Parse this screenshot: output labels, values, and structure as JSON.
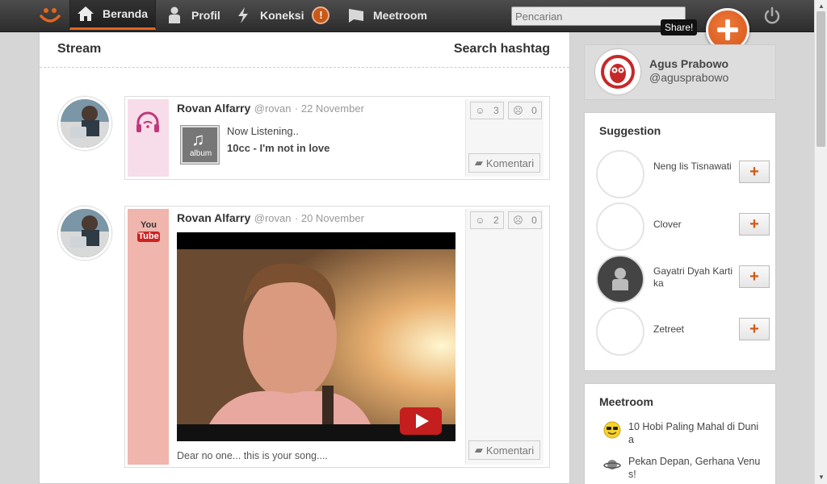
{
  "nav": {
    "items": [
      {
        "label": "Beranda",
        "icon": "home-icon"
      },
      {
        "label": "Profil",
        "icon": "person-icon"
      },
      {
        "label": "Koneksi",
        "icon": "lightning-icon",
        "badge": "!"
      },
      {
        "label": "Meetroom",
        "icon": "chat-bubble-icon"
      }
    ],
    "search_placeholder": "Pencarian",
    "share_tooltip": "Share!"
  },
  "stream": {
    "title": "Stream",
    "hashtag_label": "Search hashtag",
    "posts": [
      {
        "author": "Rovan Alfarry",
        "handle": "@rovan",
        "date": "· 22 November",
        "type_icon": "headphones-icon",
        "listening_label": "Now Listening..",
        "album_label": "album",
        "track": "10cc - I'm not in love",
        "likes": "3",
        "dislikes": "0",
        "comment_label": "Komentari"
      },
      {
        "author": "Rovan Alfarry",
        "handle": "@rovan",
        "date": "· 20 November",
        "type_icon": "youtube-icon",
        "yt_top": "You",
        "yt_bottom": "Tube",
        "caption": "Dear no one... this is your song....",
        "likes": "2",
        "dislikes": "0",
        "comment_label": "Komentari"
      }
    ]
  },
  "profile": {
    "name": "Agus Prabowo",
    "handle": "@agusprabowo"
  },
  "suggestion": {
    "title": "Suggestion",
    "people": [
      {
        "name": "Neng lis Tisnawati"
      },
      {
        "name": "Clover"
      },
      {
        "name": "Gayatri Dyah Kartika"
      },
      {
        "name": "Zetreet"
      }
    ],
    "follow_label": "+"
  },
  "meetroom": {
    "title": "Meetroom",
    "items": [
      {
        "text": "10 Hobi Paling Mahal di Dunia",
        "icon": "sunglasses-smiley-icon"
      },
      {
        "text": "Pekan Depan, Gerhana Venus!",
        "icon": "planet-icon"
      }
    ]
  },
  "colors": {
    "accent": "#e2661f",
    "topbar": "#3a3a3a",
    "music_strip": "#f7dce9",
    "youtube_strip": "#f0b5ad"
  }
}
